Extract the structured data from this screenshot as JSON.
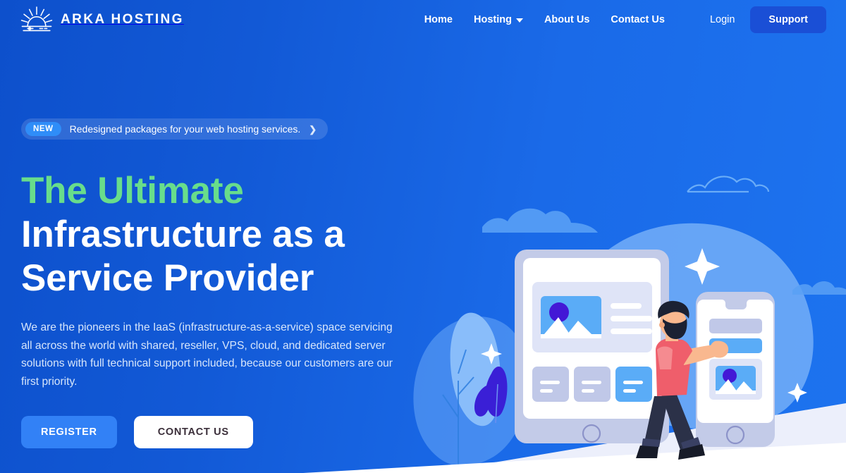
{
  "header": {
    "brand": {
      "name": "ARKA HOSTING",
      "logo_icon": "sunrise-icon"
    },
    "nav_items": [
      {
        "label": "Home",
        "has_dropdown": false
      },
      {
        "label": "Hosting",
        "has_dropdown": true
      },
      {
        "label": "About Us",
        "has_dropdown": false
      },
      {
        "label": "Contact Us",
        "has_dropdown": false
      }
    ],
    "login_label": "Login",
    "support_label": "Support"
  },
  "hero": {
    "announcement": {
      "badge": "NEW",
      "text": "Redesigned packages for your web hosting services.",
      "arrow_icon": "chevron-right-icon"
    },
    "headline_accent": "The Ultimate",
    "headline_line2": "Infrastructure as a",
    "headline_line3": "Service Provider",
    "paragraph": "We are the pioneers in the IaaS (infrastructure-as-a-service) space servicing all across the world with shared, reseller, VPS, cloud, and dedicated server solutions with full technical support included, because our customers are our first priority.",
    "primary_cta": "REGISTER",
    "secondary_cta": "CONTACT US"
  },
  "illustration": {
    "name": "iaas-devices-illustration",
    "elements": [
      "cloud-filled-left",
      "cloud-outline-top",
      "cloud-filled-right",
      "blob-backdrop",
      "leaf-outline",
      "leaf-purple",
      "sparkle-large",
      "sparkle-small-left",
      "sparkle-small-right",
      "tablet-device",
      "phone-device",
      "person-figure",
      "ground-wedge"
    ]
  },
  "colors": {
    "bg_gradient_from": "#0d50cc",
    "bg_gradient_to": "#1d73ef",
    "accent_green": "#68dd8b",
    "accent_blue": "#3281f6",
    "support_button": "#1a4fd6",
    "badge_blue": "#2f8df8",
    "text_light": "#d7e6fb",
    "white": "#ffffff",
    "illus_blob": "#6aa8f7",
    "illus_blob_light": "#8dc0fa",
    "illus_device_frame": "#c3cbe8",
    "illus_panel": "#dfe4f7",
    "illus_panel_alt": "#c0c8e8",
    "illus_tile_blue": "#5aacf7",
    "illus_purple": "#4318d6",
    "illus_shirt": "#ef5e6b",
    "illus_pants": "#2b3148",
    "illus_skin": "#f9b88f",
    "illus_hair": "#1b2133",
    "illus_ground": "#eceffb"
  }
}
